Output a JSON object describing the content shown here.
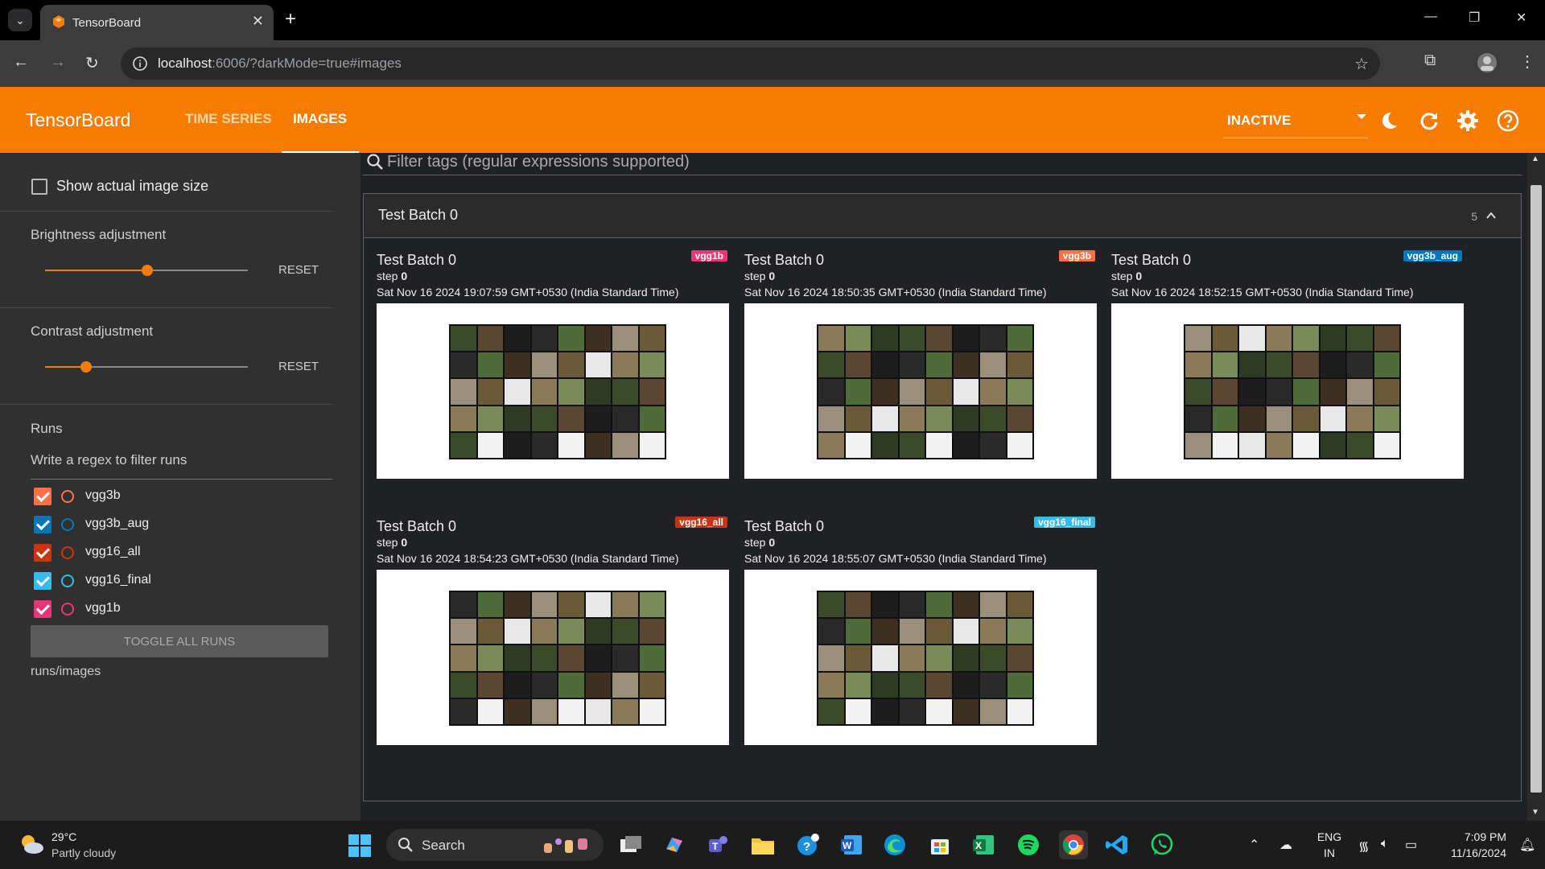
{
  "browser": {
    "tab_title": "TensorBoard",
    "url_host": "localhost",
    "url_rest": ":6006/?darkMode=true#images"
  },
  "header": {
    "logo": "TensorBoard",
    "nav": [
      {
        "label": "TIME SERIES"
      },
      {
        "label": "IMAGES"
      }
    ],
    "active_tab": "IMAGES",
    "reload_status": "INACTIVE",
    "brand_color": "#f57c00"
  },
  "sidebar": {
    "show_actual_size_label": "Show actual image size",
    "brightness": {
      "label": "Brightness adjustment",
      "reset": "RESET",
      "value": 0.5
    },
    "contrast": {
      "label": "Contrast adjustment",
      "reset": "RESET",
      "value": 0.2
    },
    "runs_title": "Runs",
    "runs_filter_placeholder": "Write a regex to filter runs",
    "runs": [
      {
        "name": "vgg3b",
        "color": "#ff7043"
      },
      {
        "name": "vgg3b_aug",
        "color": "#0077bb"
      },
      {
        "name": "vgg16_all",
        "color": "#cc3311"
      },
      {
        "name": "vgg16_final",
        "color": "#33bbee"
      },
      {
        "name": "vgg1b",
        "color": "#ee3377"
      }
    ],
    "toggle_all": "TOGGLE ALL RUNS",
    "runs_path": "runs/images"
  },
  "main": {
    "filter_placeholder": "Filter tags (regular expressions supported)",
    "group": {
      "title": "Test Batch 0",
      "count": "5"
    },
    "cards": [
      {
        "title": "Test Batch 0",
        "step_label": "step",
        "step": "0",
        "time": "Sat Nov 16 2024 19:07:59 GMT+0530 (India Standard Time)",
        "run": "vgg1b",
        "run_color": "#ee3377"
      },
      {
        "title": "Test Batch 0",
        "step_label": "step",
        "step": "0",
        "time": "Sat Nov 16 2024 18:50:35 GMT+0530 (India Standard Time)",
        "run": "vgg3b",
        "run_color": "#ff7043"
      },
      {
        "title": "Test Batch 0",
        "step_label": "step",
        "step": "0",
        "time": "Sat Nov 16 2024 18:52:15 GMT+0530 (India Standard Time)",
        "run": "vgg3b_aug",
        "run_color": "#0077bb"
      },
      {
        "title": "Test Batch 0",
        "step_label": "step",
        "step": "0",
        "time": "Sat Nov 16 2024 18:54:23 GMT+0530 (India Standard Time)",
        "run": "vgg16_all",
        "run_color": "#cc3311"
      },
      {
        "title": "Test Batch 0",
        "step_label": "step",
        "step": "0",
        "time": "Sat Nov 16 2024 18:55:07 GMT+0530 (India Standard Time)",
        "run": "vgg16_final",
        "run_color": "#33bbee"
      }
    ]
  },
  "taskbar": {
    "weather_temp": "29°C",
    "weather_desc": "Partly cloudy",
    "search_label": "Search",
    "lang_top": "ENG",
    "lang_bottom": "IN",
    "time": "7:09 PM",
    "date": "11/16/2024"
  }
}
